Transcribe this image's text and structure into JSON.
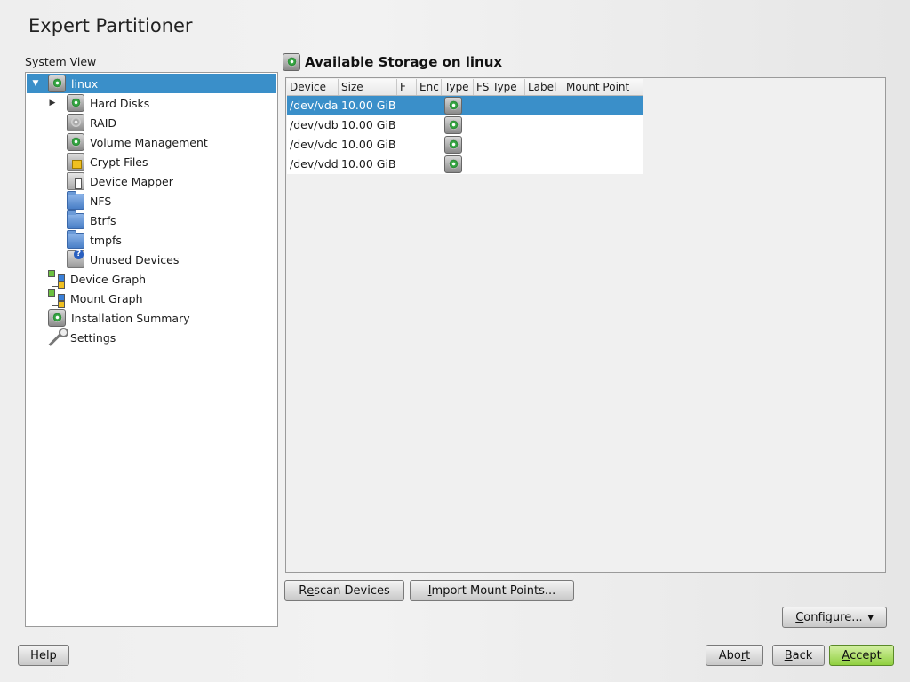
{
  "title": "Expert Partitioner",
  "system_view": {
    "label_first": "S",
    "label_rest": "ystem View"
  },
  "tree": {
    "root": {
      "label": "linux",
      "icon": "hard-disk-icon",
      "expanded": true,
      "selected": true
    },
    "items": [
      {
        "label": "Hard Disks",
        "icon": "hard-disk-icon",
        "expandable": true
      },
      {
        "label": "RAID",
        "icon": "raid-icon"
      },
      {
        "label": "Volume Management",
        "icon": "volume-icon"
      },
      {
        "label": "Crypt Files",
        "icon": "lock-icon"
      },
      {
        "label": "Device Mapper",
        "icon": "device-mapper-icon"
      },
      {
        "label": "NFS",
        "icon": "folder-icon"
      },
      {
        "label": "Btrfs",
        "icon": "folder-icon"
      },
      {
        "label": "tmpfs",
        "icon": "folder-icon"
      },
      {
        "label": "Unused Devices",
        "icon": "unused-devices-icon"
      }
    ],
    "top_items": [
      {
        "label": "Device Graph",
        "icon": "graph-icon"
      },
      {
        "label": "Mount Graph",
        "icon": "graph-icon"
      },
      {
        "label": "Installation Summary",
        "icon": "hard-disk-icon"
      },
      {
        "label": "Settings",
        "icon": "wrench-icon"
      }
    ]
  },
  "storage": {
    "heading": "Available Storage on linux",
    "columns": [
      "Device",
      "Size",
      "F",
      "Enc",
      "Type",
      "FS Type",
      "Label",
      "Mount Point"
    ],
    "rows": [
      {
        "device": "/dev/vda",
        "size": "10.00 GiB",
        "type_icon": "hard-disk-icon",
        "selected": true
      },
      {
        "device": "/dev/vdb",
        "size": "10.00 GiB",
        "type_icon": "hard-disk-icon"
      },
      {
        "device": "/dev/vdc",
        "size": "10.00 GiB",
        "type_icon": "hard-disk-icon"
      },
      {
        "device": "/dev/vdd",
        "size": "10.00 GiB",
        "type_icon": "hard-disk-icon"
      }
    ]
  },
  "buttons": {
    "rescan_first": "R",
    "rescan_u": "e",
    "rescan_rest": "scan Devices",
    "import_u": "I",
    "import_rest": "mport Mount Points...",
    "configure_u": "C",
    "configure_rest": "onfigure...",
    "help": "Help",
    "abort_pre": "Abo",
    "abort_u": "r",
    "abort_post": "t",
    "back_u": "B",
    "back_rest": "ack",
    "accept_u": "A",
    "accept_rest": "ccept"
  },
  "colors": {
    "selection": "#3a8fc9",
    "accept_button": "#90d040"
  }
}
